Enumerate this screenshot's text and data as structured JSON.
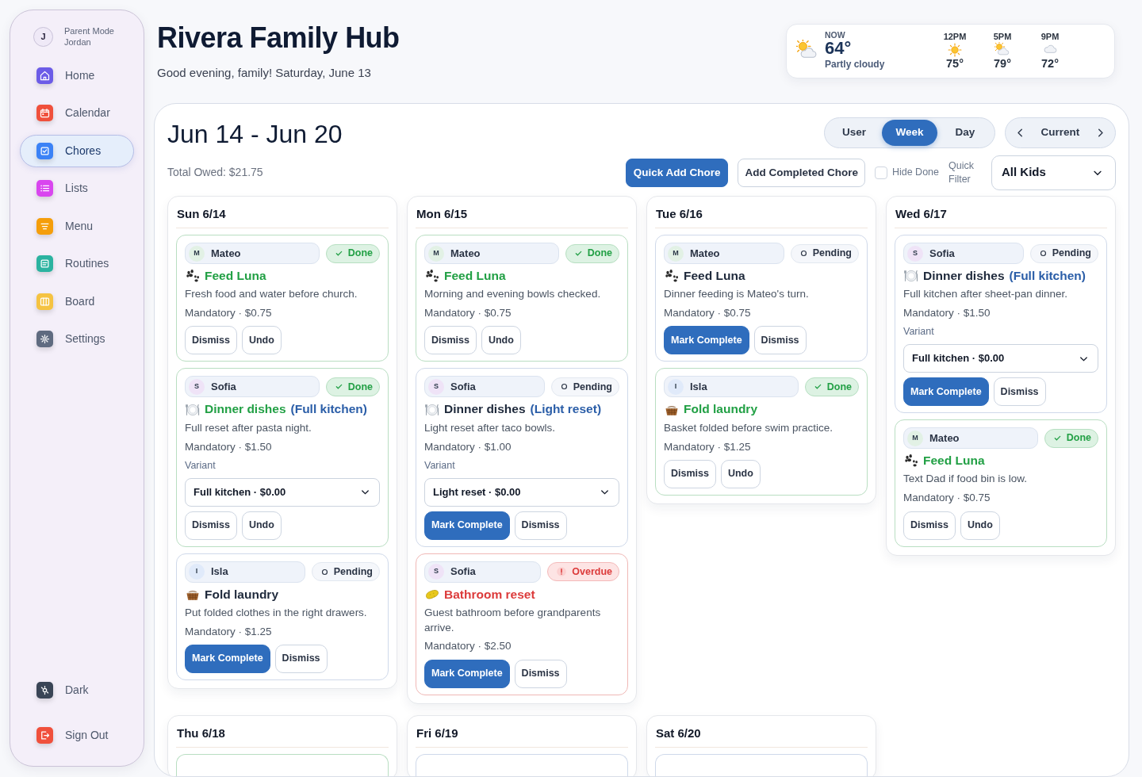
{
  "sidebar": {
    "profile": {
      "initial": "J",
      "mode": "Parent Mode",
      "name": "Jordan"
    },
    "items": [
      {
        "label": "Home",
        "color": "#6c5ce7",
        "selected": false
      },
      {
        "label": "Calendar",
        "color": "#f0503c",
        "selected": false
      },
      {
        "label": "Chores",
        "color": "#3b82f6",
        "selected": true
      },
      {
        "label": "Lists",
        "color": "#d946ef",
        "selected": false
      },
      {
        "label": "Menu",
        "color": "#f59e0b",
        "selected": false
      },
      {
        "label": "Routines",
        "color": "#2bb3a0",
        "selected": false
      },
      {
        "label": "Board",
        "color": "#f5c342",
        "selected": false
      },
      {
        "label": "Settings",
        "color": "#5f6b80",
        "selected": false
      }
    ],
    "footer": [
      {
        "label": "Dark",
        "color": "#3a4556"
      },
      {
        "label": "Sign Out",
        "color": "#f0503c"
      }
    ]
  },
  "header": {
    "title": "Rivera Family Hub",
    "subtitle": "Good evening, family! Saturday, June 13"
  },
  "weather": {
    "now": {
      "label": "NOW",
      "temp": "64°",
      "description": "Partly cloudy",
      "kind": "partly_cloudy"
    },
    "hours": [
      {
        "time": "12PM",
        "kind": "sunny",
        "temp": "75°"
      },
      {
        "time": "5PM",
        "kind": "partly_cloudy",
        "temp": "79°"
      },
      {
        "time": "9PM",
        "kind": "cloudy",
        "temp": "72°"
      }
    ]
  },
  "week": {
    "range": "Jun 14 - Jun 20",
    "total": "Total Owed: $21.75",
    "views": [
      {
        "label": "User",
        "selected": false
      },
      {
        "label": "Week",
        "selected": true
      },
      {
        "label": "Day",
        "selected": false
      }
    ],
    "nav": {
      "label": "Current"
    },
    "actions": [
      {
        "label": "Quick Add Chore",
        "kind": "primary"
      },
      {
        "label": "Add Completed Chore",
        "kind": "outline"
      }
    ],
    "hide_done": {
      "label": "Hide Done",
      "checked": false
    },
    "filter": {
      "label": "Quick Filter",
      "value": "All Kids"
    },
    "days": [
      {
        "title": "Sun 6/14",
        "chores": [
          {
            "person": {
              "initial": "M",
              "name": "Mateo",
              "color": "#e2f1e5"
            },
            "completed": true,
            "status_label": "Done",
            "kind": "pet",
            "title": "Feed Luna",
            "description": "Fresh food and water before church.",
            "meta": "Mandatory · $0.75",
            "buttons": [
              {
                "label": "Dismiss",
                "kind": "outline"
              },
              {
                "label": "Undo",
                "kind": "outline"
              }
            ]
          },
          {
            "person": {
              "initial": "S",
              "name": "Sofia",
              "color": "#efe3f7"
            },
            "completed": true,
            "status_label": "Done",
            "kind": "dishes",
            "title": "Dinner dishes",
            "variant_tag": "(Full kitchen)",
            "description": "Full reset after pasta night.",
            "meta": "Mandatory · $1.50",
            "variant": {
              "label": "Variant",
              "value": "Full kitchen · $0.00"
            },
            "buttons": [
              {
                "label": "Dismiss",
                "kind": "outline"
              },
              {
                "label": "Undo",
                "kind": "outline"
              }
            ]
          },
          {
            "person": {
              "initial": "I",
              "name": "Isla",
              "color": "#e0eafa"
            },
            "completed": false,
            "status_label": "Pending",
            "kind": "laundry",
            "title": "Fold laundry",
            "description": "Put folded clothes in the right drawers.",
            "meta": "Mandatory · $1.25",
            "buttons": [
              {
                "label": "Mark Complete",
                "kind": "primary"
              },
              {
                "label": "Dismiss",
                "kind": "outline"
              }
            ]
          }
        ]
      },
      {
        "title": "Mon 6/15",
        "chores": [
          {
            "person": {
              "initial": "M",
              "name": "Mateo",
              "color": "#e2f1e5"
            },
            "completed": true,
            "status_label": "Done",
            "kind": "pet",
            "title": "Feed Luna",
            "description": "Morning and evening bowls checked.",
            "meta": "Mandatory · $0.75",
            "buttons": [
              {
                "label": "Dismiss",
                "kind": "outline"
              },
              {
                "label": "Undo",
                "kind": "outline"
              }
            ]
          },
          {
            "person": {
              "initial": "S",
              "name": "Sofia",
              "color": "#efe3f7"
            },
            "completed": false,
            "status_label": "Pending",
            "kind": "dishes",
            "title": "Dinner dishes",
            "variant_tag": "(Light reset)",
            "description": "Light reset after taco bowls.",
            "meta": "Mandatory · $1.00",
            "variant": {
              "label": "Variant",
              "value": "Light reset · $0.00"
            },
            "buttons": [
              {
                "label": "Mark Complete",
                "kind": "primary"
              },
              {
                "label": "Dismiss",
                "kind": "outline"
              }
            ]
          },
          {
            "person": {
              "initial": "S",
              "name": "Sofia",
              "color": "#efe3f7"
            },
            "overdue": true,
            "status_label": "Overdue",
            "kind": "bathroom",
            "title": "Bathroom reset",
            "description": "Guest bathroom before grandparents arrive.",
            "meta": "Mandatory · $2.50",
            "buttons": [
              {
                "label": "Mark Complete",
                "kind": "primary"
              },
              {
                "label": "Dismiss",
                "kind": "outline"
              }
            ]
          }
        ]
      },
      {
        "title": "Tue 6/16",
        "chores": [
          {
            "person": {
              "initial": "M",
              "name": "Mateo",
              "color": "#e2f1e5"
            },
            "completed": false,
            "status_label": "Pending",
            "kind": "pet",
            "title": "Feed Luna",
            "description": "Dinner feeding is Mateo's turn.",
            "meta": "Mandatory · $0.75",
            "buttons": [
              {
                "label": "Mark Complete",
                "kind": "primary"
              },
              {
                "label": "Dismiss",
                "kind": "outline"
              }
            ]
          },
          {
            "person": {
              "initial": "I",
              "name": "Isla",
              "color": "#e0eafa"
            },
            "completed": true,
            "status_label": "Done",
            "kind": "laundry",
            "title": "Fold laundry",
            "description": "Basket folded before swim practice.",
            "meta": "Mandatory · $1.25",
            "buttons": [
              {
                "label": "Dismiss",
                "kind": "outline"
              },
              {
                "label": "Undo",
                "kind": "outline"
              }
            ]
          }
        ]
      },
      {
        "title": "Wed 6/17",
        "chores": [
          {
            "person": {
              "initial": "S",
              "name": "Sofia",
              "color": "#efe3f7"
            },
            "completed": false,
            "status_label": "Pending",
            "kind": "dishes",
            "title": "Dinner dishes",
            "variant_tag": "(Full kitchen)",
            "description": "Full kitchen after sheet-pan dinner.",
            "meta": "Mandatory · $1.50",
            "variant": {
              "label": "Variant",
              "value": "Full kitchen · $0.00"
            },
            "buttons": [
              {
                "label": "Mark Complete",
                "kind": "primary"
              },
              {
                "label": "Dismiss",
                "kind": "outline"
              }
            ]
          },
          {
            "person": {
              "initial": "M",
              "name": "Mateo",
              "color": "#e2f1e5"
            },
            "completed": true,
            "status_label": "Done",
            "kind": "pet",
            "title": "Feed Luna",
            "description": "Text Dad if food bin is low.",
            "meta": "Mandatory · $0.75",
            "buttons": [
              {
                "label": "Dismiss",
                "kind": "outline"
              },
              {
                "label": "Undo",
                "kind": "outline"
              }
            ]
          }
        ]
      },
      {
        "title": "Thu 6/18",
        "chores": [
          {
            "completed": true
          }
        ]
      },
      {
        "title": "Fri 6/19",
        "chores": [
          {
            "completed": false
          }
        ]
      },
      {
        "title": "Sat 6/20",
        "chores": [
          {
            "completed": false
          }
        ]
      }
    ]
  }
}
